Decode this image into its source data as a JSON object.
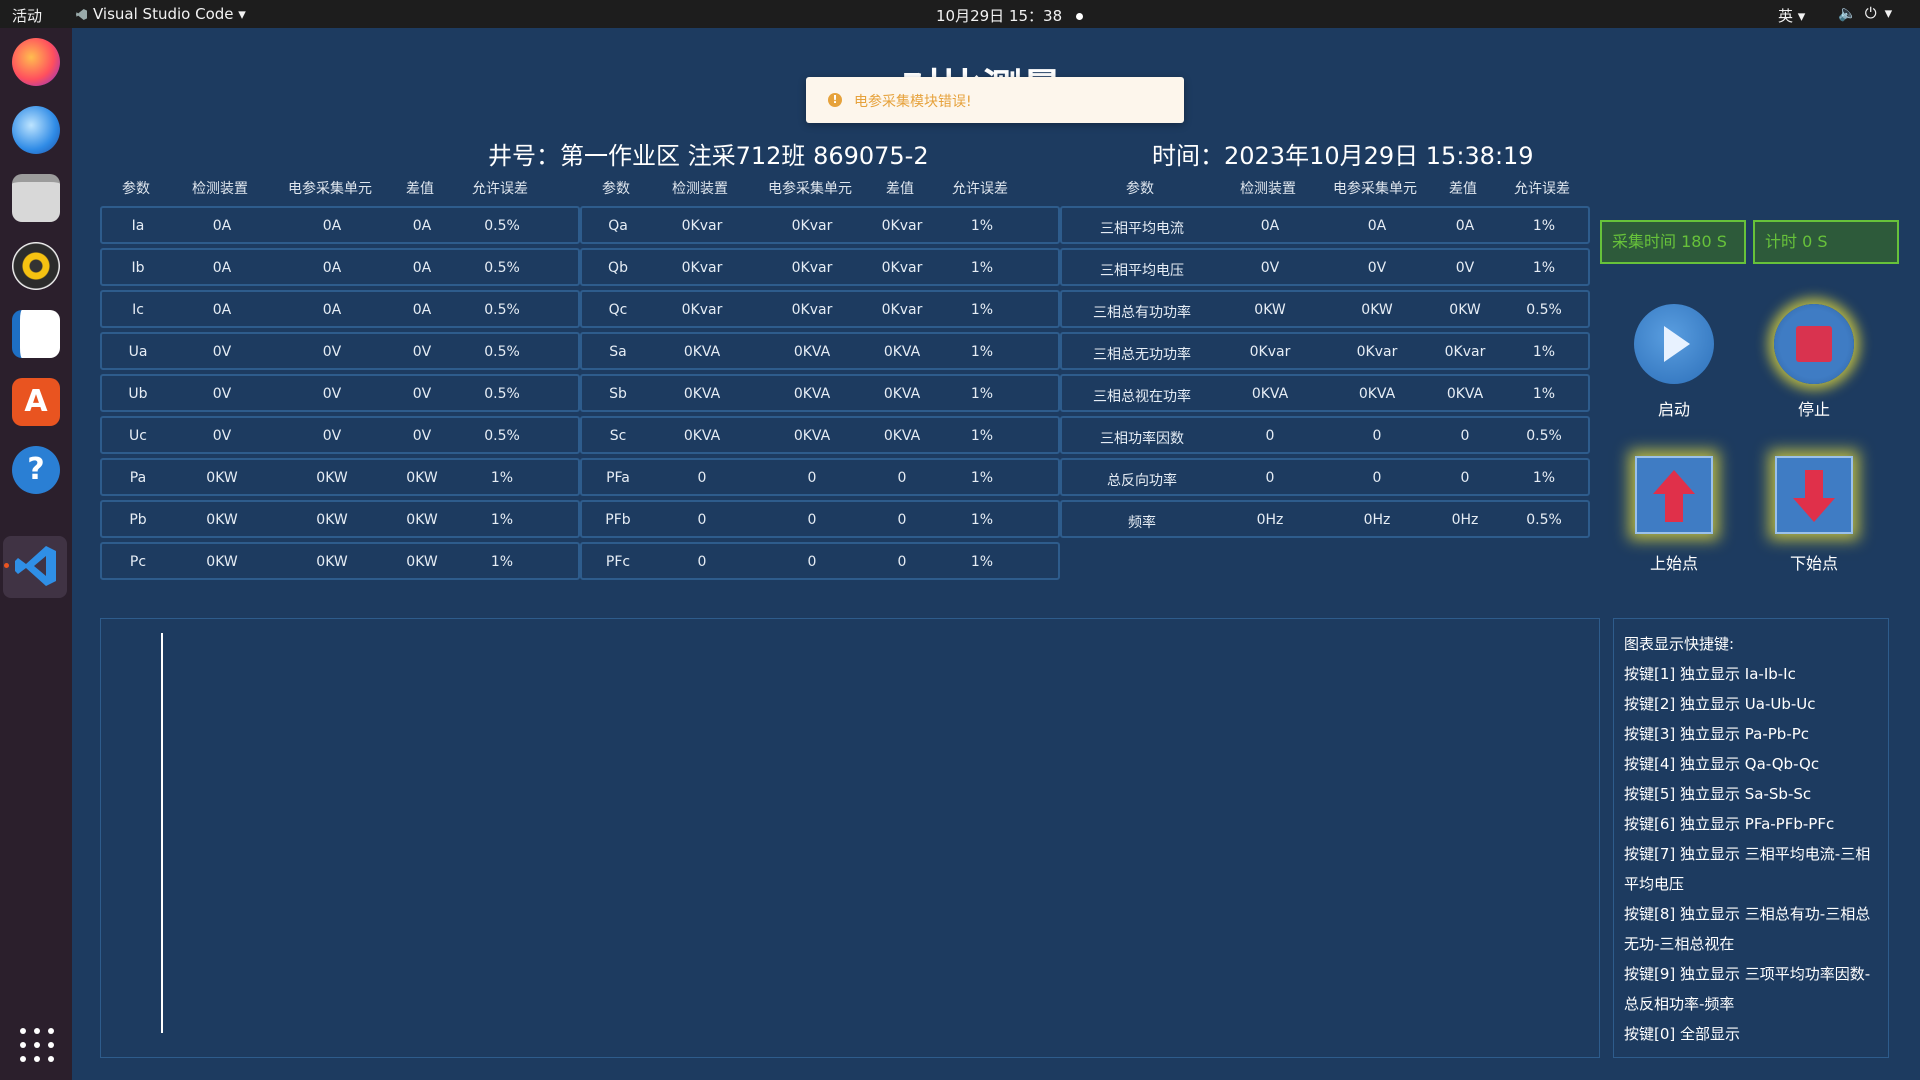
{
  "topbar": {
    "activities": "活动",
    "app_name": "Visual Studio Code",
    "clock": "10月29日  15：38",
    "ime": "英"
  },
  "dock": {
    "apps": [
      "firefox-icon",
      "thunderbird-icon",
      "files-icon",
      "rhythmbox-icon",
      "writer-icon",
      "app-center-icon",
      "help-icon",
      "vscode-icon"
    ]
  },
  "page": {
    "title": "对比测量",
    "toast": "电参采集模块错误!",
    "well": "井号：第一作业区 注采712班 869075-2",
    "time": "时间：2023年10月29日 15:38:19"
  },
  "table_headers": {
    "standard": [
      "参数",
      "检测装置",
      "电参采集单元",
      "差值",
      "允许误差"
    ]
  },
  "table1": [
    [
      "Ia",
      "0A",
      "0A",
      "0A",
      "0.5%"
    ],
    [
      "Ib",
      "0A",
      "0A",
      "0A",
      "0.5%"
    ],
    [
      "Ic",
      "0A",
      "0A",
      "0A",
      "0.5%"
    ],
    [
      "Ua",
      "0V",
      "0V",
      "0V",
      "0.5%"
    ],
    [
      "Ub",
      "0V",
      "0V",
      "0V",
      "0.5%"
    ],
    [
      "Uc",
      "0V",
      "0V",
      "0V",
      "0.5%"
    ],
    [
      "Pa",
      "0KW",
      "0KW",
      "0KW",
      "1%"
    ],
    [
      "Pb",
      "0KW",
      "0KW",
      "0KW",
      "1%"
    ],
    [
      "Pc",
      "0KW",
      "0KW",
      "0KW",
      "1%"
    ]
  ],
  "table2": [
    [
      "Qa",
      "0Kvar",
      "0Kvar",
      "0Kvar",
      "1%"
    ],
    [
      "Qb",
      "0Kvar",
      "0Kvar",
      "0Kvar",
      "1%"
    ],
    [
      "Qc",
      "0Kvar",
      "0Kvar",
      "0Kvar",
      "1%"
    ],
    [
      "Sa",
      "0KVA",
      "0KVA",
      "0KVA",
      "1%"
    ],
    [
      "Sb",
      "0KVA",
      "0KVA",
      "0KVA",
      "1%"
    ],
    [
      "Sc",
      "0KVA",
      "0KVA",
      "0KVA",
      "1%"
    ],
    [
      "PFa",
      "0",
      "0",
      "0",
      "1%"
    ],
    [
      "PFb",
      "0",
      "0",
      "0",
      "1%"
    ],
    [
      "PFc",
      "0",
      "0",
      "0",
      "1%"
    ]
  ],
  "table3": [
    [
      "三相平均电流",
      "0A",
      "0A",
      "0A",
      "1%"
    ],
    [
      "三相平均电压",
      "0V",
      "0V",
      "0V",
      "1%"
    ],
    [
      "三相总有功功率",
      "0KW",
      "0KW",
      "0KW",
      "0.5%"
    ],
    [
      "三相总无功功率",
      "0Kvar",
      "0Kvar",
      "0Kvar",
      "1%"
    ],
    [
      "三相总视在功率",
      "0KVA",
      "0KVA",
      "0KVA",
      "1%"
    ],
    [
      "三相功率因数",
      "0",
      "0",
      "0",
      "0.5%"
    ],
    [
      "总反向功率",
      "0",
      "0",
      "0",
      "1%"
    ],
    [
      "频率",
      "0Hz",
      "0Hz",
      "0Hz",
      "0.5%"
    ]
  ],
  "controls": {
    "collect_time": "采集时间 180 S",
    "timer": "计时 0 S",
    "start": "启动",
    "stop": "停止",
    "upper_point": "上始点",
    "lower_point": "下始点"
  },
  "shortcuts": {
    "title": "图表显示快捷键:",
    "items": [
      "按键[1] 独立显示 Ia-Ib-Ic",
      "按键[2] 独立显示 Ua-Ub-Uc",
      "按键[3] 独立显示 Pa-Pb-Pc",
      "按键[4] 独立显示 Qa-Qb-Qc",
      "按键[5] 独立显示 Sa-Sb-Sc",
      "按键[6] 独立显示 PFa-PFb-PFc",
      "按键[7] 独立显示 三相平均电流-三相平均电压",
      "按键[8] 独立显示 三相总有功-三相总无功-三相总视在",
      "按键[9] 独立显示 三项平均功率因数-总反相功率-频率",
      "按键[0] 全部显示"
    ]
  },
  "colors": {
    "background": "#1d3b60",
    "border": "#2e5c8c",
    "green": "#67c23a",
    "warning": "#e6a23c"
  }
}
